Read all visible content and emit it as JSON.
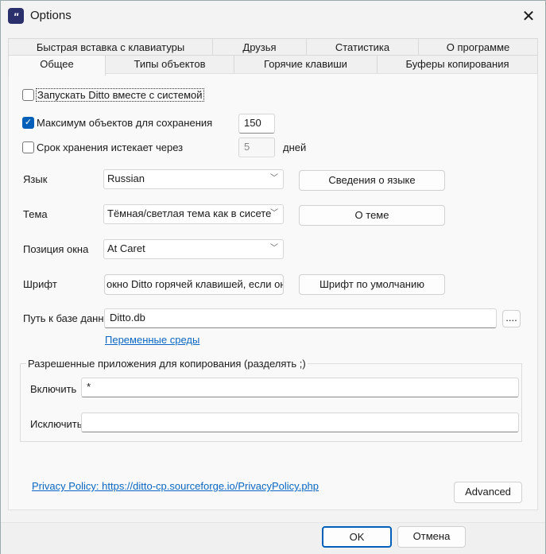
{
  "window": {
    "title": "Options",
    "app_icon": "\"",
    "close": "✕"
  },
  "tabs_row1": [
    "Быстрая вставка с клавиатуры",
    "Друзья",
    "Статистика",
    "О программе"
  ],
  "tabs_row2": [
    "Общее",
    "Типы объектов",
    "Горячие клавиши",
    "Буферы копирования"
  ],
  "general": {
    "start_with_system": {
      "label": "Запускать Ditto вместе с системой",
      "checked": false
    },
    "max_items": {
      "label": "Максимум объектов для сохранения",
      "checked": true,
      "value": "150"
    },
    "expire": {
      "label": "Срок хранения истекает через",
      "checked": false,
      "value": "5",
      "unit": "дней"
    },
    "language": {
      "label": "Язык",
      "value": "Russian",
      "button": "Сведения о языке"
    },
    "theme": {
      "label": "Тема",
      "value": "Тёмная/светлая тема как в сисете",
      "button": "О теме"
    },
    "position": {
      "label": "Позиция окна",
      "value": "At Caret"
    },
    "font": {
      "label": "Шрифт",
      "value": "окно Ditto горячей клавишей, если он",
      "button": "Шрифт по умолчанию"
    },
    "db_path": {
      "label": "Путь к базе данн",
      "value": "Ditto.db",
      "browse": "...."
    },
    "env_link": "Переменные среды",
    "allowed_apps": {
      "label": "Разрешенные приложения для копирования (разделять ;)",
      "include_label": "Включить",
      "include_value": "*",
      "exclude_label": "Исключить",
      "exclude_value": ""
    },
    "privacy_link": "Privacy Policy: https://ditto-cp.sourceforge.io/PrivacyPolicy.php",
    "advanced": "Advanced"
  },
  "footer": {
    "ok": "OK",
    "cancel": "Отмена"
  }
}
